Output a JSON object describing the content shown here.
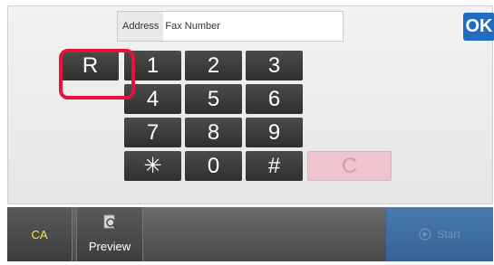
{
  "address": {
    "label": "Address",
    "value": "Fax Number"
  },
  "ok_label": "OK",
  "keys": {
    "r": "R",
    "k1": "1",
    "k2": "2",
    "k3": "3",
    "k4": "4",
    "k5": "5",
    "k6": "6",
    "k7": "7",
    "k8": "8",
    "k9": "9",
    "star": "✳",
    "k0": "0",
    "hash": "#",
    "clear": "C"
  },
  "bottom": {
    "ca_label": "CA",
    "preview_label": "Preview",
    "start_label": "Start"
  },
  "icons": {
    "preview": "preview-magnifier-icon",
    "start": "start-icon"
  },
  "colors": {
    "ok": "#1f6cc2",
    "highlight": "#e2143a",
    "clear_key": "#f0c4cf",
    "ca_text": "#ffe14a"
  }
}
